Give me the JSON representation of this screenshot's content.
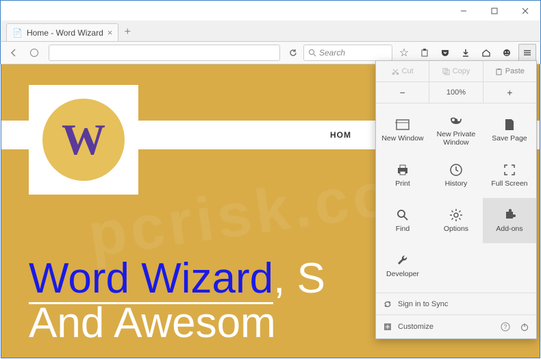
{
  "window": {
    "title": "Home - Word Wizard"
  },
  "tab": {
    "title": "Home - Word Wizard"
  },
  "toolbar": {
    "search_placeholder": "Search"
  },
  "menu": {
    "edit": {
      "cut": "Cut",
      "copy": "Copy",
      "paste": "Paste"
    },
    "zoom": {
      "level": "100%"
    },
    "items": {
      "new_window": "New Window",
      "new_private": "New Private Window",
      "save_page": "Save Page",
      "print": "Print",
      "history": "History",
      "full_screen": "Full Screen",
      "find": "Find",
      "options": "Options",
      "addons": "Add-ons",
      "developer": "Developer"
    },
    "sync": "Sign in to Sync",
    "customize": "Customize"
  },
  "page": {
    "nav_home": "HOM",
    "logo_letter": "W",
    "headline_blue": "Word Wizard",
    "headline_comma": ", S",
    "headline_line2": "And Awesom"
  }
}
